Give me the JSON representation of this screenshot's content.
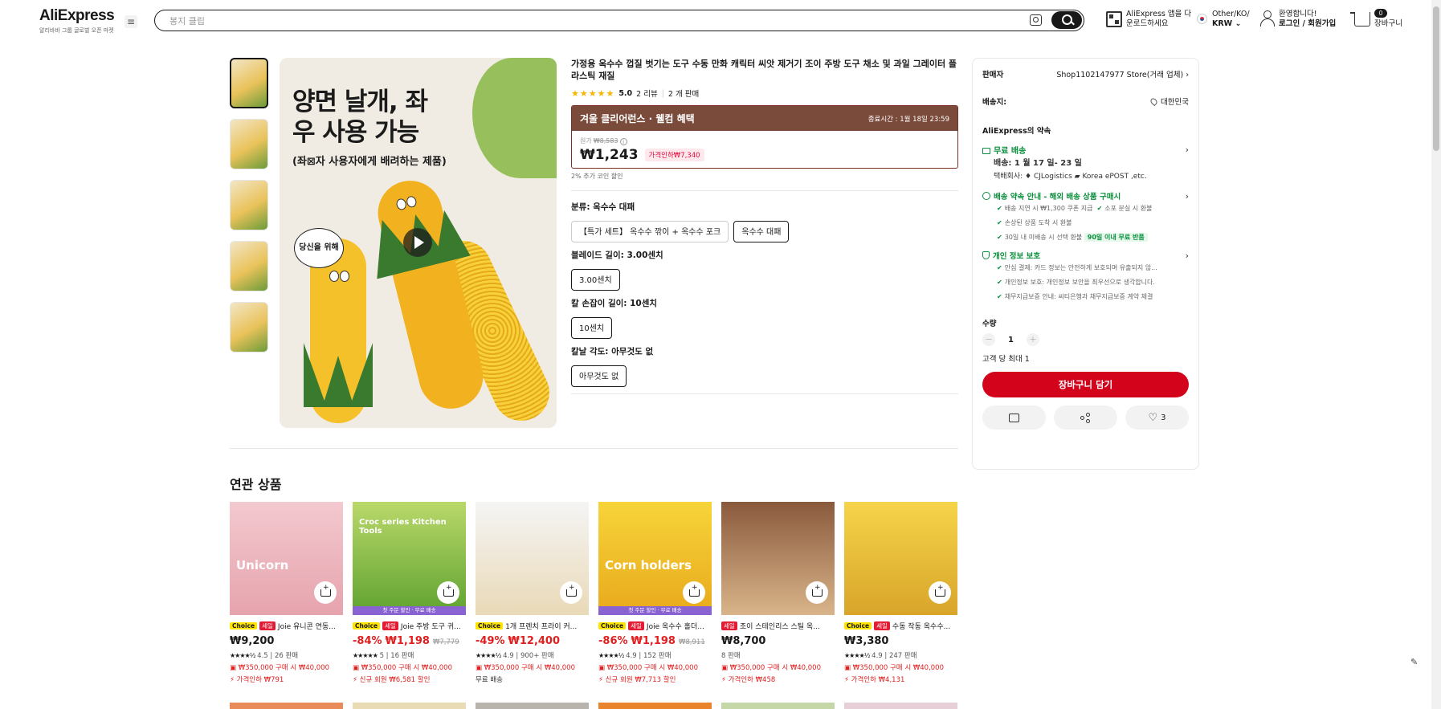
{
  "header": {
    "logo": "AliExpress",
    "logo_sub": "알리바바 그룹 글로벌 오픈 마켓",
    "search_placeholder": "봉지 클립",
    "app_line1": "AliExpress 앱을 다",
    "app_line2": "운로드하세요",
    "region_line1": "Other/KO/",
    "region_line2": "KRW ⌄",
    "user_line1": "환영합니다!",
    "user_line2": "로그인 / 회원가입",
    "cart_count": "0",
    "cart_label": "장바구니"
  },
  "gallery": {
    "headline": "양면 날개, 좌\n우 사용 가능",
    "subline": "(좌⊠자 사용자에게 배려하는 제품)",
    "bubble": "당신을 위해"
  },
  "product": {
    "title": "가정용 옥수수 껍질 벗기는 도구 수동 만화 캐릭터 씨앗 제거기 조이 주방 도구 채소 및 과일 그레이터 플라스틱 재질",
    "stars": "★★★★★",
    "rating": "5.0",
    "reviews": "2 리뷰",
    "sold": "2 개 판매",
    "promo_title": "겨울 클리어런스 · 웰컴 혜택",
    "promo_end": "종료시간 : 1월 18일 23:59",
    "orig_label": "원가",
    "orig_price": "₩8,583",
    "price": "₩1,243",
    "discount": "가격인하₩7,340",
    "coin_note": "2% 추가 코인 할인",
    "options": [
      {
        "label": "분류: 옥수수 대패",
        "values": [
          "【특가 세트】 옥수수 깎이 + 옥수수 포크",
          "옥수수 대패"
        ],
        "selected": 1
      },
      {
        "label": "블레이드 길이: 3.00센치",
        "values": [
          "3.00센치"
        ],
        "selected": 0
      },
      {
        "label": "칼 손잡이 길이: 10센치",
        "values": [
          "10센치"
        ],
        "selected": 0
      },
      {
        "label": "칼날 각도: 아무것도 없",
        "values": [
          "아무것도 없"
        ],
        "selected": 0
      }
    ]
  },
  "panel": {
    "seller_label": "판매자",
    "seller_name": "Shop1102147977 Store(거래 업체) ›",
    "ship_label": "배송지:",
    "ship_to": "대한민국",
    "promise_title": "AliExpress의 약속",
    "free_ship": "무료 배송",
    "delivery": "배송: 1 월 17 일- 23 일",
    "carrier": "택배회사: ♦ CJLogistics ▰ Korea ePOST ,etc.",
    "ship_promise": "배송 약속 안내 - 해외 배송 상품 구매시",
    "ship_checks": [
      "배송 지연 시 ₩1,300 쿠폰 지급",
      "소포 분실 시 환불",
      "손상된 상품 도착 시 환불",
      "30일 내 미배송 시 선택 환불"
    ],
    "return_badge": "90일 이내 무료 반품",
    "privacy_title": "개인 정보 보호",
    "privacy_checks": [
      "안심 결제: 카드 정보는 안전하게 보호되며 유출되지 않...",
      "개인정보 보호: 개인정보 보안을 최우선으로 생각합니다.",
      "채무지급보증 안내: 씨티은행과 채무지급보증 계약 체결"
    ],
    "qty_label": "수량",
    "qty": "1",
    "qty_limit": "고객 당 최대 1",
    "add_cart": "장바구니 담기",
    "likes": "3"
  },
  "related": {
    "title": "연관 상품",
    "items": [
      {
        "title": "Joie 유니콘 연동...",
        "choice": "Choice",
        "sale": "세일",
        "price": "₩9,200",
        "orig": "",
        "disc": "",
        "stars": "★★★★½",
        "rating": "4.5",
        "sold": "26 판매",
        "line1": "₩350,000 구매 시 ₩40,000",
        "line2": "가격인하 ₩791",
        "img_label": "",
        "cap": "Unicorn",
        "bg": "linear-gradient(180deg,#f3c9cf,#e6a3ad)"
      },
      {
        "title": "Joie 주방 도구 귀...",
        "choice": "Choice",
        "sale": "세일",
        "price": "₩1,198",
        "orig": "₩7,779",
        "disc": "-84%",
        "stars": "★★★★★",
        "rating": "5",
        "sold": "16 판매",
        "line1": "₩350,000 구매 시 ₩40,000",
        "line2": "신규 회원 ₩6,581 할인",
        "img_label": "첫 주문 할인 · 무료 배송",
        "cap": "Croc series Kitchen Tools",
        "bg": "linear-gradient(180deg,#b9d86a,#5fa22f)"
      },
      {
        "title": "1개 프렌치 프라이 커...",
        "choice": "Choice",
        "sale": "",
        "price": "₩12,400",
        "orig": "",
        "disc": "-49%",
        "stars": "★★★★½",
        "rating": "4.9",
        "sold": "900+ 판매",
        "line1": "₩350,000 구매 시 ₩40,000",
        "line2": "무료 배송",
        "img_label": "",
        "cap": "",
        "bg": "linear-gradient(180deg,#f5f5f5,#e9d9b7)"
      },
      {
        "title": "Joie 옥수수 홀더...",
        "choice": "Choice",
        "sale": "세일",
        "price": "₩1,198",
        "orig": "₩8,911",
        "disc": "-86%",
        "stars": "★★★★½",
        "rating": "4.9",
        "sold": "152 판매",
        "line1": "₩350,000 구매 시 ₩40,000",
        "line2": "신규 회원 ₩7,713 할인",
        "img_label": "첫 주문 할인 · 무료 배송",
        "cap": "Corn holders",
        "bg": "linear-gradient(180deg,#f7d43a,#e8a91c)"
      },
      {
        "title": "조이 스테인리스 스틸 옥...",
        "choice": "",
        "sale": "세일",
        "price": "₩8,700",
        "orig": "",
        "disc": "",
        "stars": "",
        "rating": "",
        "sold": "8 판매",
        "line1": "₩350,000 구매 시 ₩40,000",
        "line2": "가격인하 ₩458",
        "img_label": "",
        "cap": "",
        "bg": "linear-gradient(180deg,#8a5a3c,#d9b48a)"
      },
      {
        "title": "수동 작동 옥수수...",
        "choice": "Choice",
        "sale": "세일",
        "price": "₩3,380",
        "orig": "",
        "disc": "",
        "stars": "★★★★½",
        "rating": "4.9",
        "sold": "247 판매",
        "line1": "₩350,000 구매 시 ₩40,000",
        "line2": "가격인하 ₩4,131",
        "img_label": "",
        "cap": "",
        "bg": "linear-gradient(180deg,#f6d44a,#d8a52a)"
      }
    ]
  },
  "colors": {
    "accent": "#d3031c",
    "green": "#0a8f3c",
    "promo": "#7a4a3a"
  }
}
